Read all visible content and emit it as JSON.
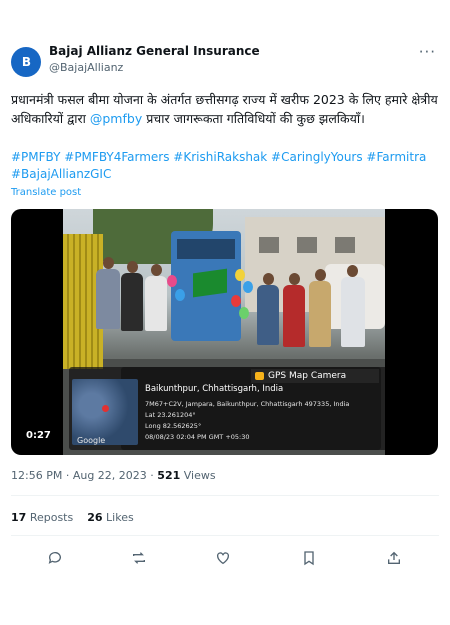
{
  "account": {
    "avatar_text": "B",
    "display_name": "Bajaj Allianz General Insurance",
    "handle": "@BajajAllianz"
  },
  "tweet": {
    "text_part1": "प्रधानमंत्री फसल बीमा योजना के अंतर्गत छत्तीसगढ़ राज्य में खरीफ 2023 के लिए हमारे क्षेत्रीय अधिकारियों द्वारा ",
    "mention": "@pmfby",
    "text_part2": " प्रचार जागरूकता गतिविधियों की कुछ झलकियाँ।",
    "hashtags": "#PMFBY #PMFBY4Farmers #KrishiRakshak #CaringlyYours #Farmitra #BajajAllianzGIC",
    "translate_label": "Translate post"
  },
  "media": {
    "duration": "0:27",
    "gps": {
      "badge": "GPS Map Camera",
      "place": "Baikunthpur, Chhattisgarh, India",
      "address": "7M67+C2V, Jampara, Baikunthpur, Chhattisgarh 497335, India",
      "lat": "Lat 23.261204°",
      "long": "Long 82.562625°",
      "datetime": "08/08/23 02:04 PM GMT +05:30",
      "map_label": "Google"
    }
  },
  "meta": {
    "time": "12:56 PM",
    "date": "Aug 22, 2023",
    "views_count": "521",
    "views_label": "Views"
  },
  "stats": {
    "reposts_count": "17",
    "reposts_label": "Reposts",
    "likes_count": "26",
    "likes_label": "Likes"
  },
  "colors": {
    "brand": "#1767c4",
    "link": "#1d9bf0",
    "muted": "#536471"
  },
  "icons": [
    "more-icon",
    "reply-icon",
    "repost-icon",
    "like-icon",
    "bookmark-icon",
    "share-icon"
  ]
}
